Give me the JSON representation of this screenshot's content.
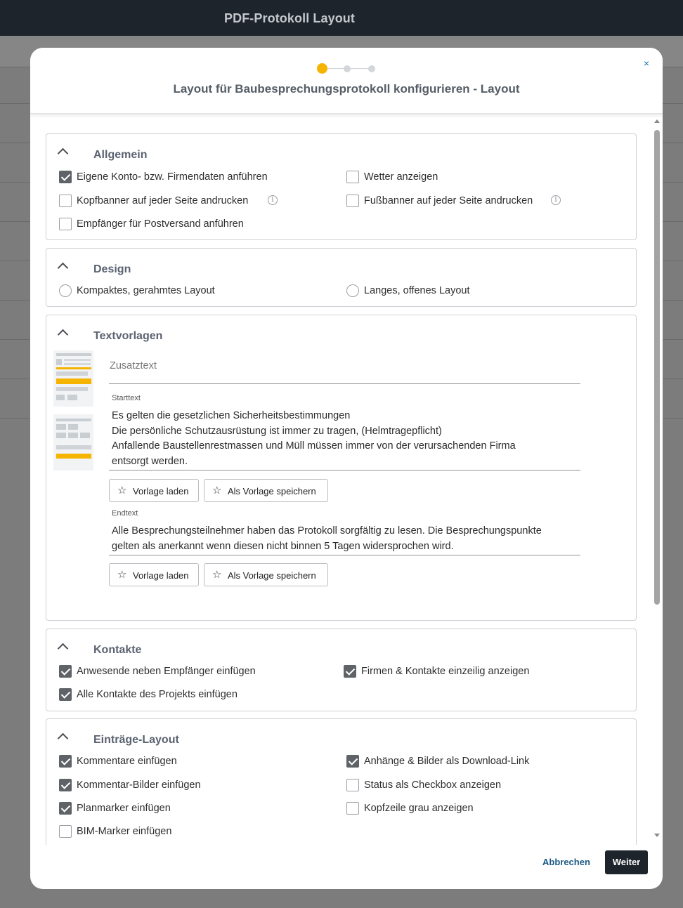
{
  "app": {
    "title": "PDF-Protokoll Layout"
  },
  "dialog": {
    "title": "Layout für Baubesprechungsprotokoll konfigurieren - Layout",
    "close_symbol": "×",
    "steps": [
      {
        "state": "active",
        "color": "#f5b400"
      },
      {
        "state": "inactive",
        "color": "#d3d6da"
      },
      {
        "state": "inactive",
        "color": "#d3d6da"
      }
    ]
  },
  "sections": {
    "allgemein": {
      "title": "Allgemein",
      "options": [
        {
          "label": "Eigene Konto- bzw. Firmendaten anführen",
          "checked": true
        },
        {
          "label": "Wetter anzeigen",
          "checked": false
        },
        {
          "label": "Kopfbanner auf jeder Seite andrucken",
          "checked": false,
          "info": true
        },
        {
          "label": "Fußbanner auf jeder Seite andrucken",
          "checked": false,
          "info": true
        },
        {
          "label": "Empfänger für Postversand anführen",
          "checked": false
        }
      ]
    },
    "design": {
      "title": "Design",
      "options": [
        {
          "label": "Kompaktes, gerahmtes Layout",
          "selected": false
        },
        {
          "label": "Langes, offenes Layout",
          "selected": false
        }
      ]
    },
    "textvorlagen": {
      "title": "Textvorlagen",
      "zusatztext_placeholder": "Zusatztext",
      "starttext_label": "Starttext",
      "starttext_lines": [
        "Es gelten die gesetzlichen Sicherheitsbestimmungen",
        "Die persönliche Schutzausrüstung ist immer zu tragen, (Helmtragepflicht)",
        "Anfallende Baustellenrestmassen und Müll müssen immer von der verursachenden Firma",
        "entsorgt werden."
      ],
      "endtext_label": "Endtext",
      "endtext_lines": [
        "Alle Besprechungsteilnehmer haben das Protokoll sorgfältig zu lesen. Die Besprechungspunkte",
        "gelten als anerkannt wenn diesen nicht binnen 5 Tagen widersprochen wird."
      ],
      "load_template_label": "Vorlage laden",
      "save_template_label": "Als Vorlage speichern"
    },
    "kontakte": {
      "title": "Kontakte",
      "options": [
        {
          "label": "Anwesende neben Empfänger einfügen",
          "checked": true
        },
        {
          "label": "Firmen & Kontakte einzeilig anzeigen",
          "checked": true
        },
        {
          "label": "Alle Kontakte des Projekts einfügen",
          "checked": true
        }
      ]
    },
    "eintraege": {
      "title": "Einträge-Layout",
      "options": [
        {
          "label": "Kommentare einfügen",
          "checked": true
        },
        {
          "label": "Anhänge & Bilder als Download-Link",
          "checked": true
        },
        {
          "label": "Kommentar-Bilder einfügen",
          "checked": true
        },
        {
          "label": "Status als Checkbox anzeigen",
          "checked": false
        },
        {
          "label": "Planmarker einfügen",
          "checked": true
        },
        {
          "label": "Kopfzeile grau anzeigen",
          "checked": false
        },
        {
          "label": "BIM-Marker einfügen",
          "checked": false
        }
      ]
    }
  },
  "footer": {
    "cancel_label": "Abbrechen",
    "next_label": "Weiter"
  },
  "icons": {
    "collapse": "chevron-up-icon",
    "info": "info-icon",
    "star": "star-icon",
    "close": "close-icon"
  },
  "colors": {
    "accent": "#f5b400",
    "dark": "#1d242b",
    "link": "#1b5a86"
  }
}
